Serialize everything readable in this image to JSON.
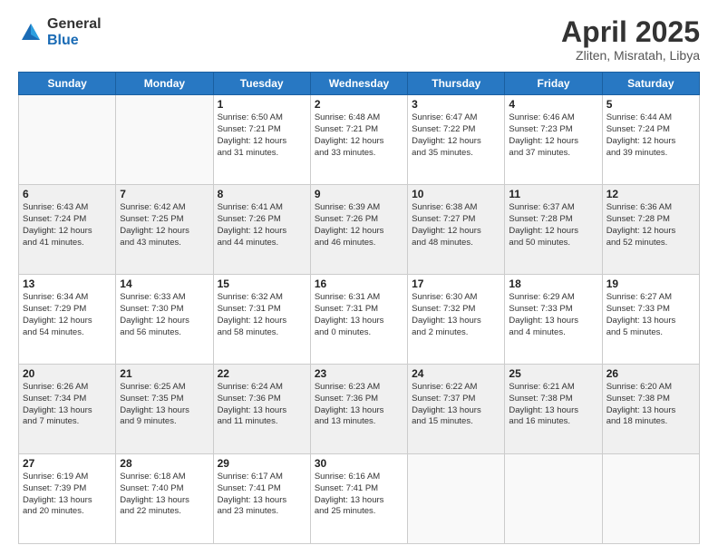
{
  "header": {
    "logo_general": "General",
    "logo_blue": "Blue",
    "month_title": "April 2025",
    "location": "Zliten, Misratah, Libya"
  },
  "weekdays": [
    "Sunday",
    "Monday",
    "Tuesday",
    "Wednesday",
    "Thursday",
    "Friday",
    "Saturday"
  ],
  "weeks": [
    [
      {
        "day": "",
        "info": ""
      },
      {
        "day": "",
        "info": ""
      },
      {
        "day": "1",
        "info": "Sunrise: 6:50 AM\nSunset: 7:21 PM\nDaylight: 12 hours\nand 31 minutes."
      },
      {
        "day": "2",
        "info": "Sunrise: 6:48 AM\nSunset: 7:21 PM\nDaylight: 12 hours\nand 33 minutes."
      },
      {
        "day": "3",
        "info": "Sunrise: 6:47 AM\nSunset: 7:22 PM\nDaylight: 12 hours\nand 35 minutes."
      },
      {
        "day": "4",
        "info": "Sunrise: 6:46 AM\nSunset: 7:23 PM\nDaylight: 12 hours\nand 37 minutes."
      },
      {
        "day": "5",
        "info": "Sunrise: 6:44 AM\nSunset: 7:24 PM\nDaylight: 12 hours\nand 39 minutes."
      }
    ],
    [
      {
        "day": "6",
        "info": "Sunrise: 6:43 AM\nSunset: 7:24 PM\nDaylight: 12 hours\nand 41 minutes."
      },
      {
        "day": "7",
        "info": "Sunrise: 6:42 AM\nSunset: 7:25 PM\nDaylight: 12 hours\nand 43 minutes."
      },
      {
        "day": "8",
        "info": "Sunrise: 6:41 AM\nSunset: 7:26 PM\nDaylight: 12 hours\nand 44 minutes."
      },
      {
        "day": "9",
        "info": "Sunrise: 6:39 AM\nSunset: 7:26 PM\nDaylight: 12 hours\nand 46 minutes."
      },
      {
        "day": "10",
        "info": "Sunrise: 6:38 AM\nSunset: 7:27 PM\nDaylight: 12 hours\nand 48 minutes."
      },
      {
        "day": "11",
        "info": "Sunrise: 6:37 AM\nSunset: 7:28 PM\nDaylight: 12 hours\nand 50 minutes."
      },
      {
        "day": "12",
        "info": "Sunrise: 6:36 AM\nSunset: 7:28 PM\nDaylight: 12 hours\nand 52 minutes."
      }
    ],
    [
      {
        "day": "13",
        "info": "Sunrise: 6:34 AM\nSunset: 7:29 PM\nDaylight: 12 hours\nand 54 minutes."
      },
      {
        "day": "14",
        "info": "Sunrise: 6:33 AM\nSunset: 7:30 PM\nDaylight: 12 hours\nand 56 minutes."
      },
      {
        "day": "15",
        "info": "Sunrise: 6:32 AM\nSunset: 7:31 PM\nDaylight: 12 hours\nand 58 minutes."
      },
      {
        "day": "16",
        "info": "Sunrise: 6:31 AM\nSunset: 7:31 PM\nDaylight: 13 hours\nand 0 minutes."
      },
      {
        "day": "17",
        "info": "Sunrise: 6:30 AM\nSunset: 7:32 PM\nDaylight: 13 hours\nand 2 minutes."
      },
      {
        "day": "18",
        "info": "Sunrise: 6:29 AM\nSunset: 7:33 PM\nDaylight: 13 hours\nand 4 minutes."
      },
      {
        "day": "19",
        "info": "Sunrise: 6:27 AM\nSunset: 7:33 PM\nDaylight: 13 hours\nand 5 minutes."
      }
    ],
    [
      {
        "day": "20",
        "info": "Sunrise: 6:26 AM\nSunset: 7:34 PM\nDaylight: 13 hours\nand 7 minutes."
      },
      {
        "day": "21",
        "info": "Sunrise: 6:25 AM\nSunset: 7:35 PM\nDaylight: 13 hours\nand 9 minutes."
      },
      {
        "day": "22",
        "info": "Sunrise: 6:24 AM\nSunset: 7:36 PM\nDaylight: 13 hours\nand 11 minutes."
      },
      {
        "day": "23",
        "info": "Sunrise: 6:23 AM\nSunset: 7:36 PM\nDaylight: 13 hours\nand 13 minutes."
      },
      {
        "day": "24",
        "info": "Sunrise: 6:22 AM\nSunset: 7:37 PM\nDaylight: 13 hours\nand 15 minutes."
      },
      {
        "day": "25",
        "info": "Sunrise: 6:21 AM\nSunset: 7:38 PM\nDaylight: 13 hours\nand 16 minutes."
      },
      {
        "day": "26",
        "info": "Sunrise: 6:20 AM\nSunset: 7:38 PM\nDaylight: 13 hours\nand 18 minutes."
      }
    ],
    [
      {
        "day": "27",
        "info": "Sunrise: 6:19 AM\nSunset: 7:39 PM\nDaylight: 13 hours\nand 20 minutes."
      },
      {
        "day": "28",
        "info": "Sunrise: 6:18 AM\nSunset: 7:40 PM\nDaylight: 13 hours\nand 22 minutes."
      },
      {
        "day": "29",
        "info": "Sunrise: 6:17 AM\nSunset: 7:41 PM\nDaylight: 13 hours\nand 23 minutes."
      },
      {
        "day": "30",
        "info": "Sunrise: 6:16 AM\nSunset: 7:41 PM\nDaylight: 13 hours\nand 25 minutes."
      },
      {
        "day": "",
        "info": ""
      },
      {
        "day": "",
        "info": ""
      },
      {
        "day": "",
        "info": ""
      }
    ]
  ]
}
